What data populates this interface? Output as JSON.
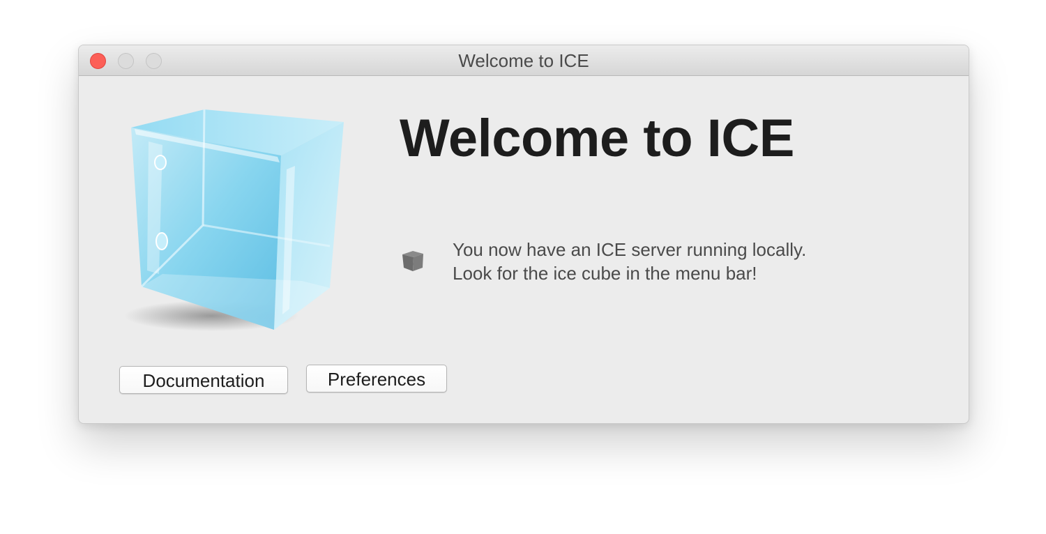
{
  "window": {
    "title": "Welcome to ICE"
  },
  "icons": {
    "app_icon": "ice-cube-icon",
    "status_icon": "menubar-cube-icon"
  },
  "main": {
    "heading": "Welcome to ICE",
    "message_line_1": "You now have an ICE server running locally.",
    "message_line_2": "Look for the ice cube in the menu bar!"
  },
  "buttons": {
    "documentation_label": "Documentation",
    "preferences_label": "Preferences"
  },
  "colors": {
    "close_button": "#fc5f57",
    "ice_blue": "#5cc6ea",
    "background": "#ececec"
  }
}
